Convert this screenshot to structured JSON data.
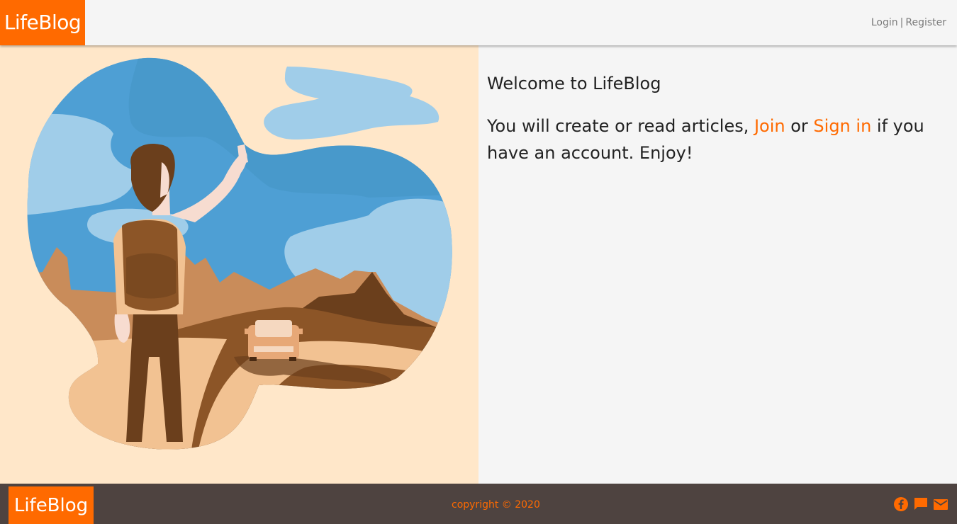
{
  "header": {
    "logo": "LifeBlog",
    "login_label": "Login",
    "separator": "|",
    "register_label": "Register"
  },
  "hero": {
    "welcome": "Welcome to LifeBlog",
    "intro_prefix": "You will create or read articles, ",
    "join_label": "Join",
    "or_text": " or ",
    "signin_label": "Sign in",
    "intro_suffix": " if you have an account. Enjoy!"
  },
  "footer": {
    "logo": "LifeBlog",
    "copyright": "copyright © 2020",
    "social_icons": [
      "facebook-icon",
      "chat-icon",
      "mail-icon"
    ]
  },
  "colors": {
    "brand": "#ff6a00",
    "footer_bg": "#4e4340",
    "hero_bg": "#ffe7c9"
  }
}
